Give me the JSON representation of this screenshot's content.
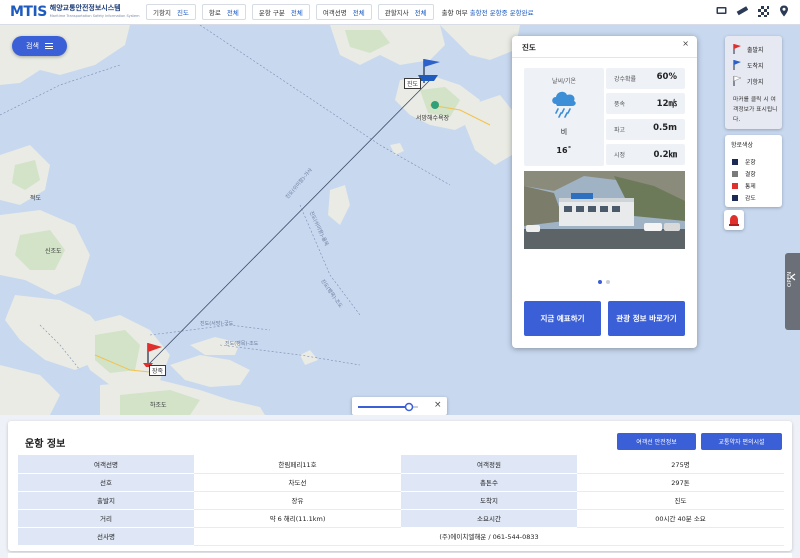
{
  "app": {
    "logo_mark": "MTIS",
    "logo_text": "해양교통안전정보시스템",
    "logo_subtext": "Maritime Transportation Safety Information System"
  },
  "filters": [
    {
      "label": "기항지",
      "value": "진도"
    },
    {
      "label": "항로",
      "value": "전체"
    },
    {
      "label": "운항 구분",
      "value": "전체"
    },
    {
      "label": "여객선명",
      "value": "전체"
    },
    {
      "label": "관할지사",
      "value": "전체"
    }
  ],
  "route_filter": {
    "label": "출항 여부",
    "value": "출항전 운항중 운항완료"
  },
  "header_icons": [
    "monitor-icon",
    "ruler-icon",
    "checker-icon",
    "location-pin-icon"
  ],
  "search": {
    "label": "검색"
  },
  "map_labels": {
    "jindo_port": "진도",
    "seomang": "서망해수욕장",
    "jeoldo": "적도",
    "sinjo": "신조도",
    "jangjuk": "장죽",
    "hajodo": "하조도",
    "route_1": "진도(쉬미항)-가사",
    "route_2": "진도(쉬미항)-율목",
    "route_3": "진도(팽목)-조도",
    "route_4": "진도(팽목)-조도",
    "route_5": "진도(서망)-국도"
  },
  "popup": {
    "title": "진도",
    "weather_label": "날씨/기온",
    "weather_desc": "비",
    "temperature": "16˚",
    "stats": [
      {
        "label": "강수확률",
        "value": "60%"
      },
      {
        "label": "풍속",
        "value": "12㎧"
      },
      {
        "label": "파고",
        "value": "0.5m"
      },
      {
        "label": "시정",
        "value": "0.2㎞"
      }
    ],
    "btn_reserve": "지금 예표하기",
    "btn_tour": "관광 정보 바로가기"
  },
  "legend": {
    "items": [
      {
        "label": "출발지",
        "color": "#e0302e"
      },
      {
        "label": "도착지",
        "color": "#2b61c9"
      },
      {
        "label": "기항지",
        "color": "#ffffff"
      }
    ],
    "note": "마커를 클릭 시 여객정보가 표시됩니다.",
    "status_title": "항로색상",
    "status": [
      {
        "label": "운항",
        "color": "#1a2a55"
      },
      {
        "label": "결항",
        "color": "#7a7a7a"
      },
      {
        "label": "통제",
        "color": "#e0302e"
      },
      {
        "label": "감도",
        "color": "#1a2a55"
      }
    ]
  },
  "open_tab": "OPEN",
  "zoom": {
    "level": 0.85
  },
  "panel": {
    "title": "운항 정보",
    "btn_safety": "여객선 안전정보",
    "btn_facilities": "교통약자 편의시설",
    "rows": [
      [
        "여객선명",
        "한림페리11호",
        "여객정원",
        "275명"
      ],
      [
        "선호",
        "차도선",
        "총톤수",
        "297톤"
      ],
      [
        "출발지",
        "장유",
        "도착지",
        "진도"
      ],
      [
        "거리",
        "약 6 해리(11.1km)",
        "소요시간",
        "00시간 40분 소요"
      ],
      [
        "선사명",
        "(주)에이치엘해운 / 061-544-0833",
        "",
        ""
      ]
    ]
  }
}
